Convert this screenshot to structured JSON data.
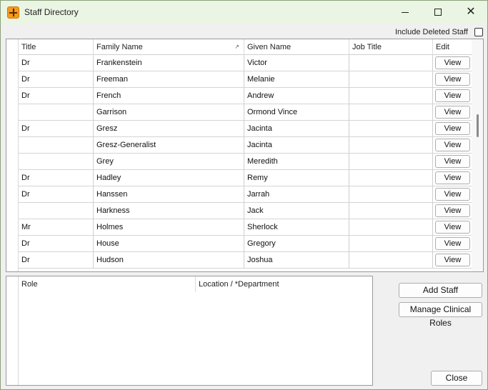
{
  "window": {
    "title": "Staff Directory",
    "icon": "plus-app-icon"
  },
  "filters": {
    "include_deleted_label": "Include Deleted Staff",
    "include_deleted_checked": false
  },
  "grid": {
    "columns": [
      "Title",
      "Family Name",
      "Given Name",
      "Job Title",
      "Edit"
    ],
    "sorted_column": "Family Name",
    "rows": [
      {
        "title": "Dr",
        "family": "Frankenstein",
        "given": "Victor",
        "job": "",
        "edit": "View"
      },
      {
        "title": "Dr",
        "family": "Freeman",
        "given": "Melanie",
        "job": "",
        "edit": "View"
      },
      {
        "title": "Dr",
        "family": "French",
        "given": "Andrew",
        "job": "",
        "edit": "View"
      },
      {
        "title": "",
        "family": "Garrison",
        "given": "Ormond Vince",
        "job": "",
        "edit": "View"
      },
      {
        "title": "Dr",
        "family": "Gresz",
        "given": "Jacinta",
        "job": "",
        "edit": "View"
      },
      {
        "title": "",
        "family": "Gresz-Generalist",
        "given": "Jacinta",
        "job": "",
        "edit": "View"
      },
      {
        "title": "",
        "family": "Grey",
        "given": "Meredith",
        "job": "",
        "edit": "View"
      },
      {
        "title": "Dr",
        "family": "Hadley",
        "given": "Remy",
        "job": "",
        "edit": "View"
      },
      {
        "title": "Dr",
        "family": "Hanssen",
        "given": "Jarrah",
        "job": "",
        "edit": "View"
      },
      {
        "title": "",
        "family": "Harkness",
        "given": "Jack",
        "job": "",
        "edit": "View"
      },
      {
        "title": "Mr",
        "family": "Holmes",
        "given": "Sherlock",
        "job": "",
        "edit": "View"
      },
      {
        "title": "Dr",
        "family": "House",
        "given": "Gregory",
        "job": "",
        "edit": "View"
      },
      {
        "title": "Dr",
        "family": "Hudson",
        "given": "Joshua",
        "job": "",
        "edit": "View"
      }
    ]
  },
  "roles": {
    "columns": [
      "Role",
      "Location / *Department"
    ]
  },
  "buttons": {
    "add_staff": "Add Staff",
    "manage_roles": "Manage Clinical Roles",
    "close": "Close"
  }
}
